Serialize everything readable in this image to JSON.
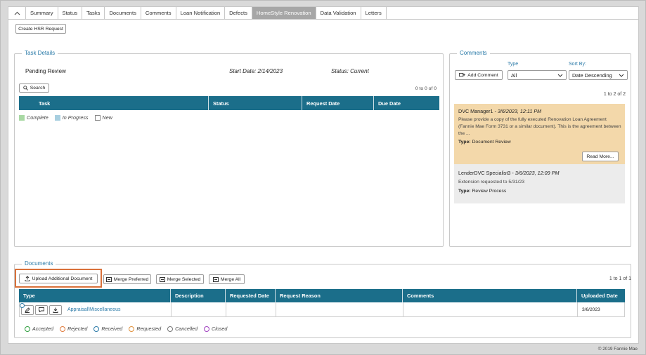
{
  "tabs": [
    {
      "label": "Summary"
    },
    {
      "label": "Status"
    },
    {
      "label": "Tasks"
    },
    {
      "label": "Documents"
    },
    {
      "label": "Comments"
    },
    {
      "label": "Loan Notification"
    },
    {
      "label": "Defects"
    },
    {
      "label": "HomeStyle Renovation"
    },
    {
      "label": "Data Validation"
    },
    {
      "label": "Letters"
    }
  ],
  "create_hsr_label": "Create HSR Request",
  "task_details": {
    "legend": "Task Details",
    "pending": "Pending Review",
    "start_date": "Start Date: 2/14/2023",
    "status": "Status: Current",
    "search_label": "Search",
    "count": "0 to 0 of 0",
    "columns": [
      "Task",
      "Status",
      "Request Date",
      "Due Date"
    ],
    "legend_items": [
      "Complete",
      "In Progress",
      "New"
    ]
  },
  "comments": {
    "legend": "Comments",
    "type_label": "Type",
    "sort_label": "Sort By:",
    "add_label": "Add Comment",
    "type_value": "All",
    "sort_value": "Date Descending",
    "count": "1 to 2 of 2",
    "items": [
      {
        "author": "DVC Manager1",
        "date": " - 3/6/2023, 12:11 PM",
        "text": "Please provide a copy of the fully executed Renovation Loan Agreement (Fannie Mae Form 3731 or a similar document). This is the agreement between the ...",
        "type_label": "Type:",
        "type_value": "Document Review",
        "read_more": "Read More..."
      },
      {
        "author": "LenderDVC Specialist3",
        "date": " - 3/6/2023, 12:09 PM",
        "text": "Extension requested to 5/31/23",
        "type_label": "Type:",
        "type_value": "Review Process"
      }
    ]
  },
  "documents": {
    "legend": "Documents",
    "upload_label": "Upload Additional Document",
    "merge_preferred": "Merge Preferred",
    "merge_selected": "Merge Selected",
    "merge_all": "Merge All",
    "count": "1 to 1 of 1",
    "columns": [
      "Type",
      "Description",
      "Requested Date",
      "Request Reason",
      "Comments",
      "Uploaded Date"
    ],
    "row": {
      "type": "Appraisal\\Miscellaneous",
      "uploaded": "3/6/2023"
    },
    "status_legend": [
      {
        "label": "Accepted",
        "color": "#2e9e3e"
      },
      {
        "label": "Rejected",
        "color": "#e07a3a"
      },
      {
        "label": "Received",
        "color": "#2a7aa8"
      },
      {
        "label": "Requested",
        "color": "#e0903a"
      },
      {
        "label": "Cancelled",
        "color": "#777777"
      },
      {
        "label": "Closed",
        "color": "#a040c0"
      }
    ]
  },
  "footer": "© 2019 Fannie Mae",
  "colors": {
    "header_teal": "#1b6e8a",
    "highlight_orange": "#d9713a",
    "complete_green": "#a9d9a4",
    "progress_blue": "#a8cfe0"
  }
}
